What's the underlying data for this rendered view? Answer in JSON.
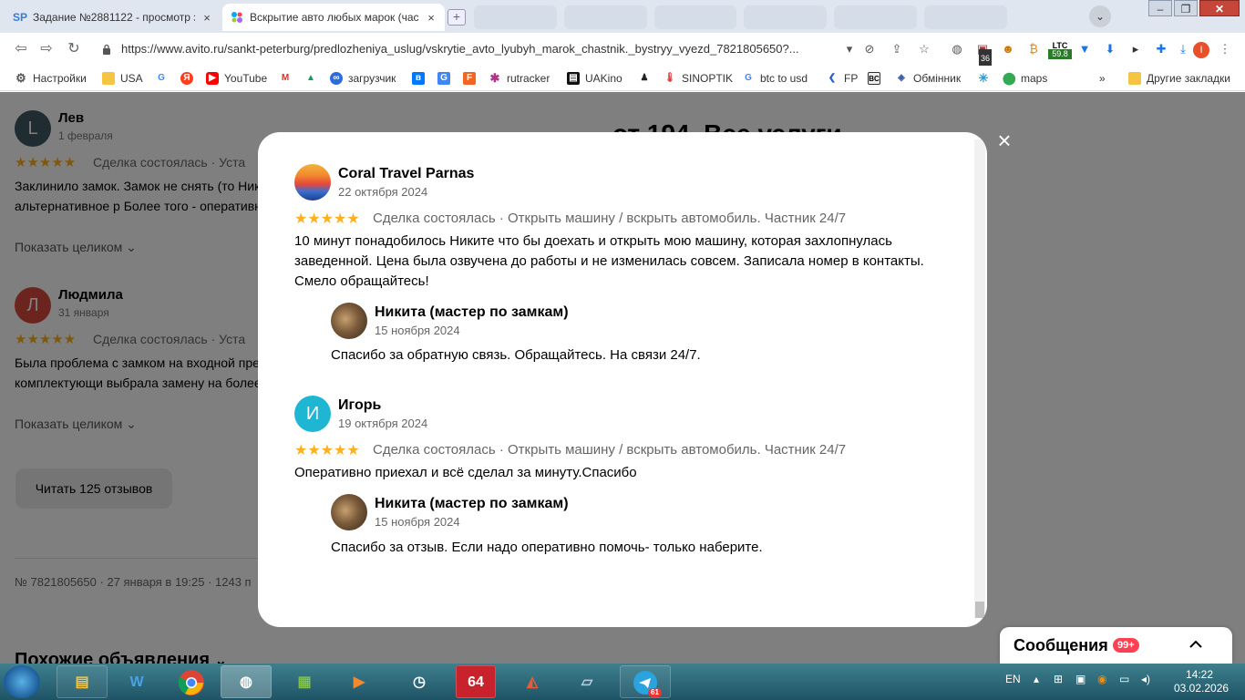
{
  "browser": {
    "tabs": [
      {
        "favicon": "SP",
        "title": "Задание №2881122 - просмотр з",
        "close": "×"
      },
      {
        "favicon": "avito-dots",
        "title": "Вскрытие авто любых марок (час",
        "close": "×"
      }
    ],
    "new_tab": "+",
    "profile": "⌄",
    "window_controls": {
      "minimize": "–",
      "maximize": "❐",
      "close": "✕"
    },
    "url": "https://www.avito.ru/sankt-peterburg/predlozheniya_uslug/vskrytie_avto_lyubyh_marok_chastnik._bystryy_vyezd_7821805650?...",
    "extensions": {
      "badge1": "36",
      "ltc_label": "LTC",
      "ltc_value": "59.8"
    },
    "bookmarks": [
      {
        "label": "Настройки",
        "icon": "gear-icon"
      },
      {
        "label": "USA",
        "icon": "folder-icon"
      },
      {
        "label": "",
        "icon": "google-icon"
      },
      {
        "label": "",
        "icon": "yandex-icon"
      },
      {
        "label": "YouTube",
        "icon": "youtube-icon"
      },
      {
        "label": "",
        "icon": "gmail-icon"
      },
      {
        "label": "",
        "icon": "drive-icon"
      },
      {
        "label": "загрузчик",
        "icon": "infinity-icon"
      },
      {
        "label": "",
        "icon": "vk-icon"
      },
      {
        "label": "",
        "icon": "translate-icon"
      },
      {
        "label": "",
        "icon": "f-icon"
      },
      {
        "label": "rutracker",
        "icon": "rutracker-icon"
      },
      {
        "label": "UAKino",
        "icon": "uakino-icon"
      },
      {
        "label": "",
        "icon": "person-icon"
      },
      {
        "label": "SINOPTIK",
        "icon": "thermometer-icon"
      },
      {
        "label": "btc to usd",
        "icon": "google-icon"
      },
      {
        "label": "FP",
        "icon": "fp-icon"
      },
      {
        "label": "",
        "icon": "bc-icon"
      },
      {
        "label": "Обмінник",
        "icon": "exchange-icon"
      },
      {
        "label": "",
        "icon": "star-icon"
      },
      {
        "label": "maps",
        "icon": "maps-icon"
      }
    ],
    "bookmarks_more": "»",
    "other_bookmarks": "Другие закладки"
  },
  "background": {
    "title_fragment": "от 194. Все услуги",
    "reviews": [
      {
        "initial": "L",
        "avatar_color": "#3f5a66",
        "name": "Лев",
        "date": "1 февраля",
        "stars": "★★★★★",
        "deal": "Сделка состоялась · Уста",
        "text": "Заклинило замок. Замок не снять (то Никита предложил альтернативное р Более того - оперативно приехал в вс",
        "more": "Показать целиком"
      },
      {
        "initial": "Л",
        "avatar_color": "#d94b3d",
        "name": "Людмила",
        "date": "31 января",
        "stars": "★★★★★",
        "deal": "Сделка состоялась · Уста",
        "text": "Была проблема с замком на входной предложил варианты комплектующи выбрала замену на более качествен",
        "more": "Показать целиком"
      }
    ],
    "read_all": "Читать 125 отзывов",
    "meta": "№ 7821805650 · 27 января в 19:25 · 1243 п",
    "similar": "Похожие объявления"
  },
  "modal": {
    "close": "×",
    "reviews": [
      {
        "author": "Coral Travel Parnas",
        "date": "22 октября 2024",
        "stars": "★★★★★",
        "deal": "Сделка состоялась · Открыть машину / вскрыть автомобиль. Частник 24/7",
        "text": "10 минут понадобилось Никите что бы доехать и открыть мою машину, которая захлопнулась заведенной. Цена была озвучена до работы и не изменилась совсем. Записала номер в контакты. Смело обращайтесь!",
        "reply": {
          "author": "Никита (мастер по замкам)",
          "date": "15 ноября 2024",
          "text": "Спасибо за обратную связь. Обращайтесь. На связи 24/7."
        }
      },
      {
        "author": "Игорь",
        "initial": "И",
        "date": "19 октября 2024",
        "stars": "★★★★★",
        "deal": "Сделка состоялась · Открыть машину / вскрыть автомобиль. Частник 24/7",
        "text": "Оперативно приехал и всё сделал за минуту.Спасибо",
        "reply": {
          "author": "Никита (мастер по замкам)",
          "date": "15 ноября 2024",
          "text": "Спасибо за отзыв. Если надо оперативно помочь- только наберите."
        }
      }
    ]
  },
  "messages": {
    "label": "Сообщения",
    "badge": "99+",
    "chevron": "^"
  },
  "taskbar": {
    "apps": [
      "explorer",
      "shield",
      "chrome",
      "browser",
      "gpu",
      "media",
      "clock",
      "64",
      "paint",
      "notes",
      "telegram"
    ],
    "aida_label": "64",
    "telegram_badge": "61",
    "lang": "EN",
    "time": "14:22",
    "date": "03.02.2026"
  },
  "colors": {
    "accent_star": "#ffb021",
    "igor_avatar": "#1fb6d4",
    "badge": "#ff4053",
    "close_red": "#c7463a"
  }
}
